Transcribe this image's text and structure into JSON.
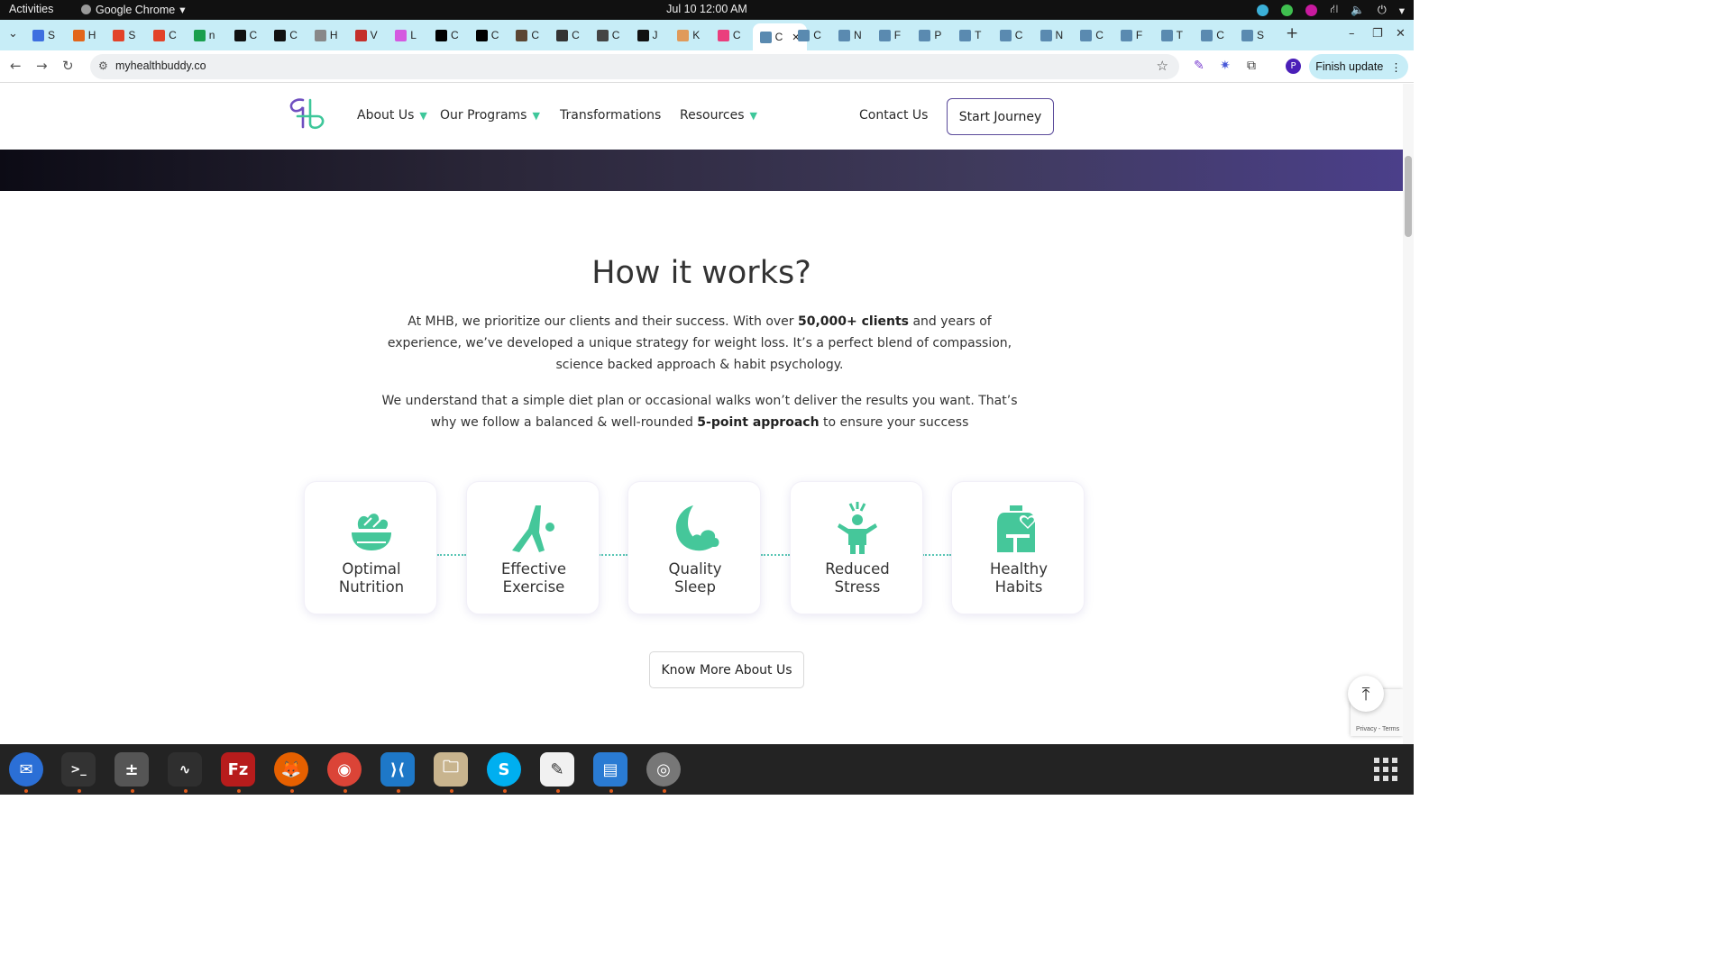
{
  "system": {
    "activities": "Activities",
    "app_name": "Google Chrome",
    "clock": "Jul 10  12:00 AM"
  },
  "browser": {
    "tabs": [
      {
        "letter": "S",
        "color": "#3d6fe0"
      },
      {
        "letter": "H",
        "color": "#e2661b"
      },
      {
        "letter": "S",
        "color": "#e24329"
      },
      {
        "letter": "C",
        "color": "#e24329"
      },
      {
        "letter": "n",
        "color": "#1a9f4e"
      },
      {
        "letter": "C",
        "color": "#111111"
      },
      {
        "letter": "C",
        "color": "#111111"
      },
      {
        "letter": "H",
        "color": "#888888"
      },
      {
        "letter": "V",
        "color": "#c4302b"
      },
      {
        "letter": "L",
        "color": "#d45ae0"
      },
      {
        "letter": "C",
        "color": "#000000"
      },
      {
        "letter": "C",
        "color": "#000000"
      },
      {
        "letter": "C",
        "color": "#5b4633"
      },
      {
        "letter": "C",
        "color": "#333333"
      },
      {
        "letter": "C",
        "color": "#444444"
      },
      {
        "letter": "J",
        "color": "#111111"
      },
      {
        "letter": "K",
        "color": "#e09a5a"
      },
      {
        "letter": "C",
        "color": "#ea3e7d"
      },
      {
        "letter": "C",
        "color": "#5a8ab0",
        "active": true
      },
      {
        "letter": "C",
        "color": "#5a8ab0"
      },
      {
        "letter": "N",
        "color": "#5a8ab0"
      },
      {
        "letter": "F",
        "color": "#5a8ab0"
      },
      {
        "letter": "P",
        "color": "#5a8ab0"
      },
      {
        "letter": "T",
        "color": "#5a8ab0"
      },
      {
        "letter": "C",
        "color": "#5a8ab0"
      },
      {
        "letter": "N",
        "color": "#5a8ab0"
      },
      {
        "letter": "C",
        "color": "#5a8ab0"
      },
      {
        "letter": "F",
        "color": "#5a8ab0"
      },
      {
        "letter": "T",
        "color": "#5a8ab0"
      },
      {
        "letter": "C",
        "color": "#5a8ab0"
      },
      {
        "letter": "S",
        "color": "#5a8ab0"
      }
    ],
    "url": "myhealthbuddy.co",
    "finish_update": "Finish update",
    "profile_initial": "P"
  },
  "site": {
    "nav": {
      "about": "About Us",
      "programs": "Our Programs",
      "transformations": "Transformations",
      "resources": "Resources",
      "contact": "Contact Us",
      "start": "Start Journey"
    },
    "how": {
      "title": "How it works?",
      "p1_a": "At MHB, we prioritize our clients and their success. With over ",
      "p1_bold": "50,000+ clients",
      "p1_b": " and years of experience, we’ve developed a unique strategy for weight loss. It’s a perfect blend of compassion, science backed approach & habit psychology.",
      "p2_a": "We understand that a simple diet plan or occasional walks won’t deliver the results you want. That’s why we follow a balanced & well-rounded ",
      "p2_bold": "5-point approach",
      "p2_b": " to ensure your success"
    },
    "pillars": [
      {
        "line1": "Optimal",
        "line2": "Nutrition",
        "icon": "salad-bowl-icon"
      },
      {
        "line1": "Effective",
        "line2": "Exercise",
        "icon": "yoga-pose-icon"
      },
      {
        "line1": "Quality",
        "line2": "Sleep",
        "icon": "moon-cloud-icon"
      },
      {
        "line1": "Reduced",
        "line2": "Stress",
        "icon": "stress-relief-icon"
      },
      {
        "line1": "Healthy",
        "line2": "Habits",
        "icon": "kettlebell-heart-icon"
      }
    ],
    "know_more": "Know More About Us",
    "recaptcha": "Privacy - Terms",
    "accent": "#45c79a"
  }
}
